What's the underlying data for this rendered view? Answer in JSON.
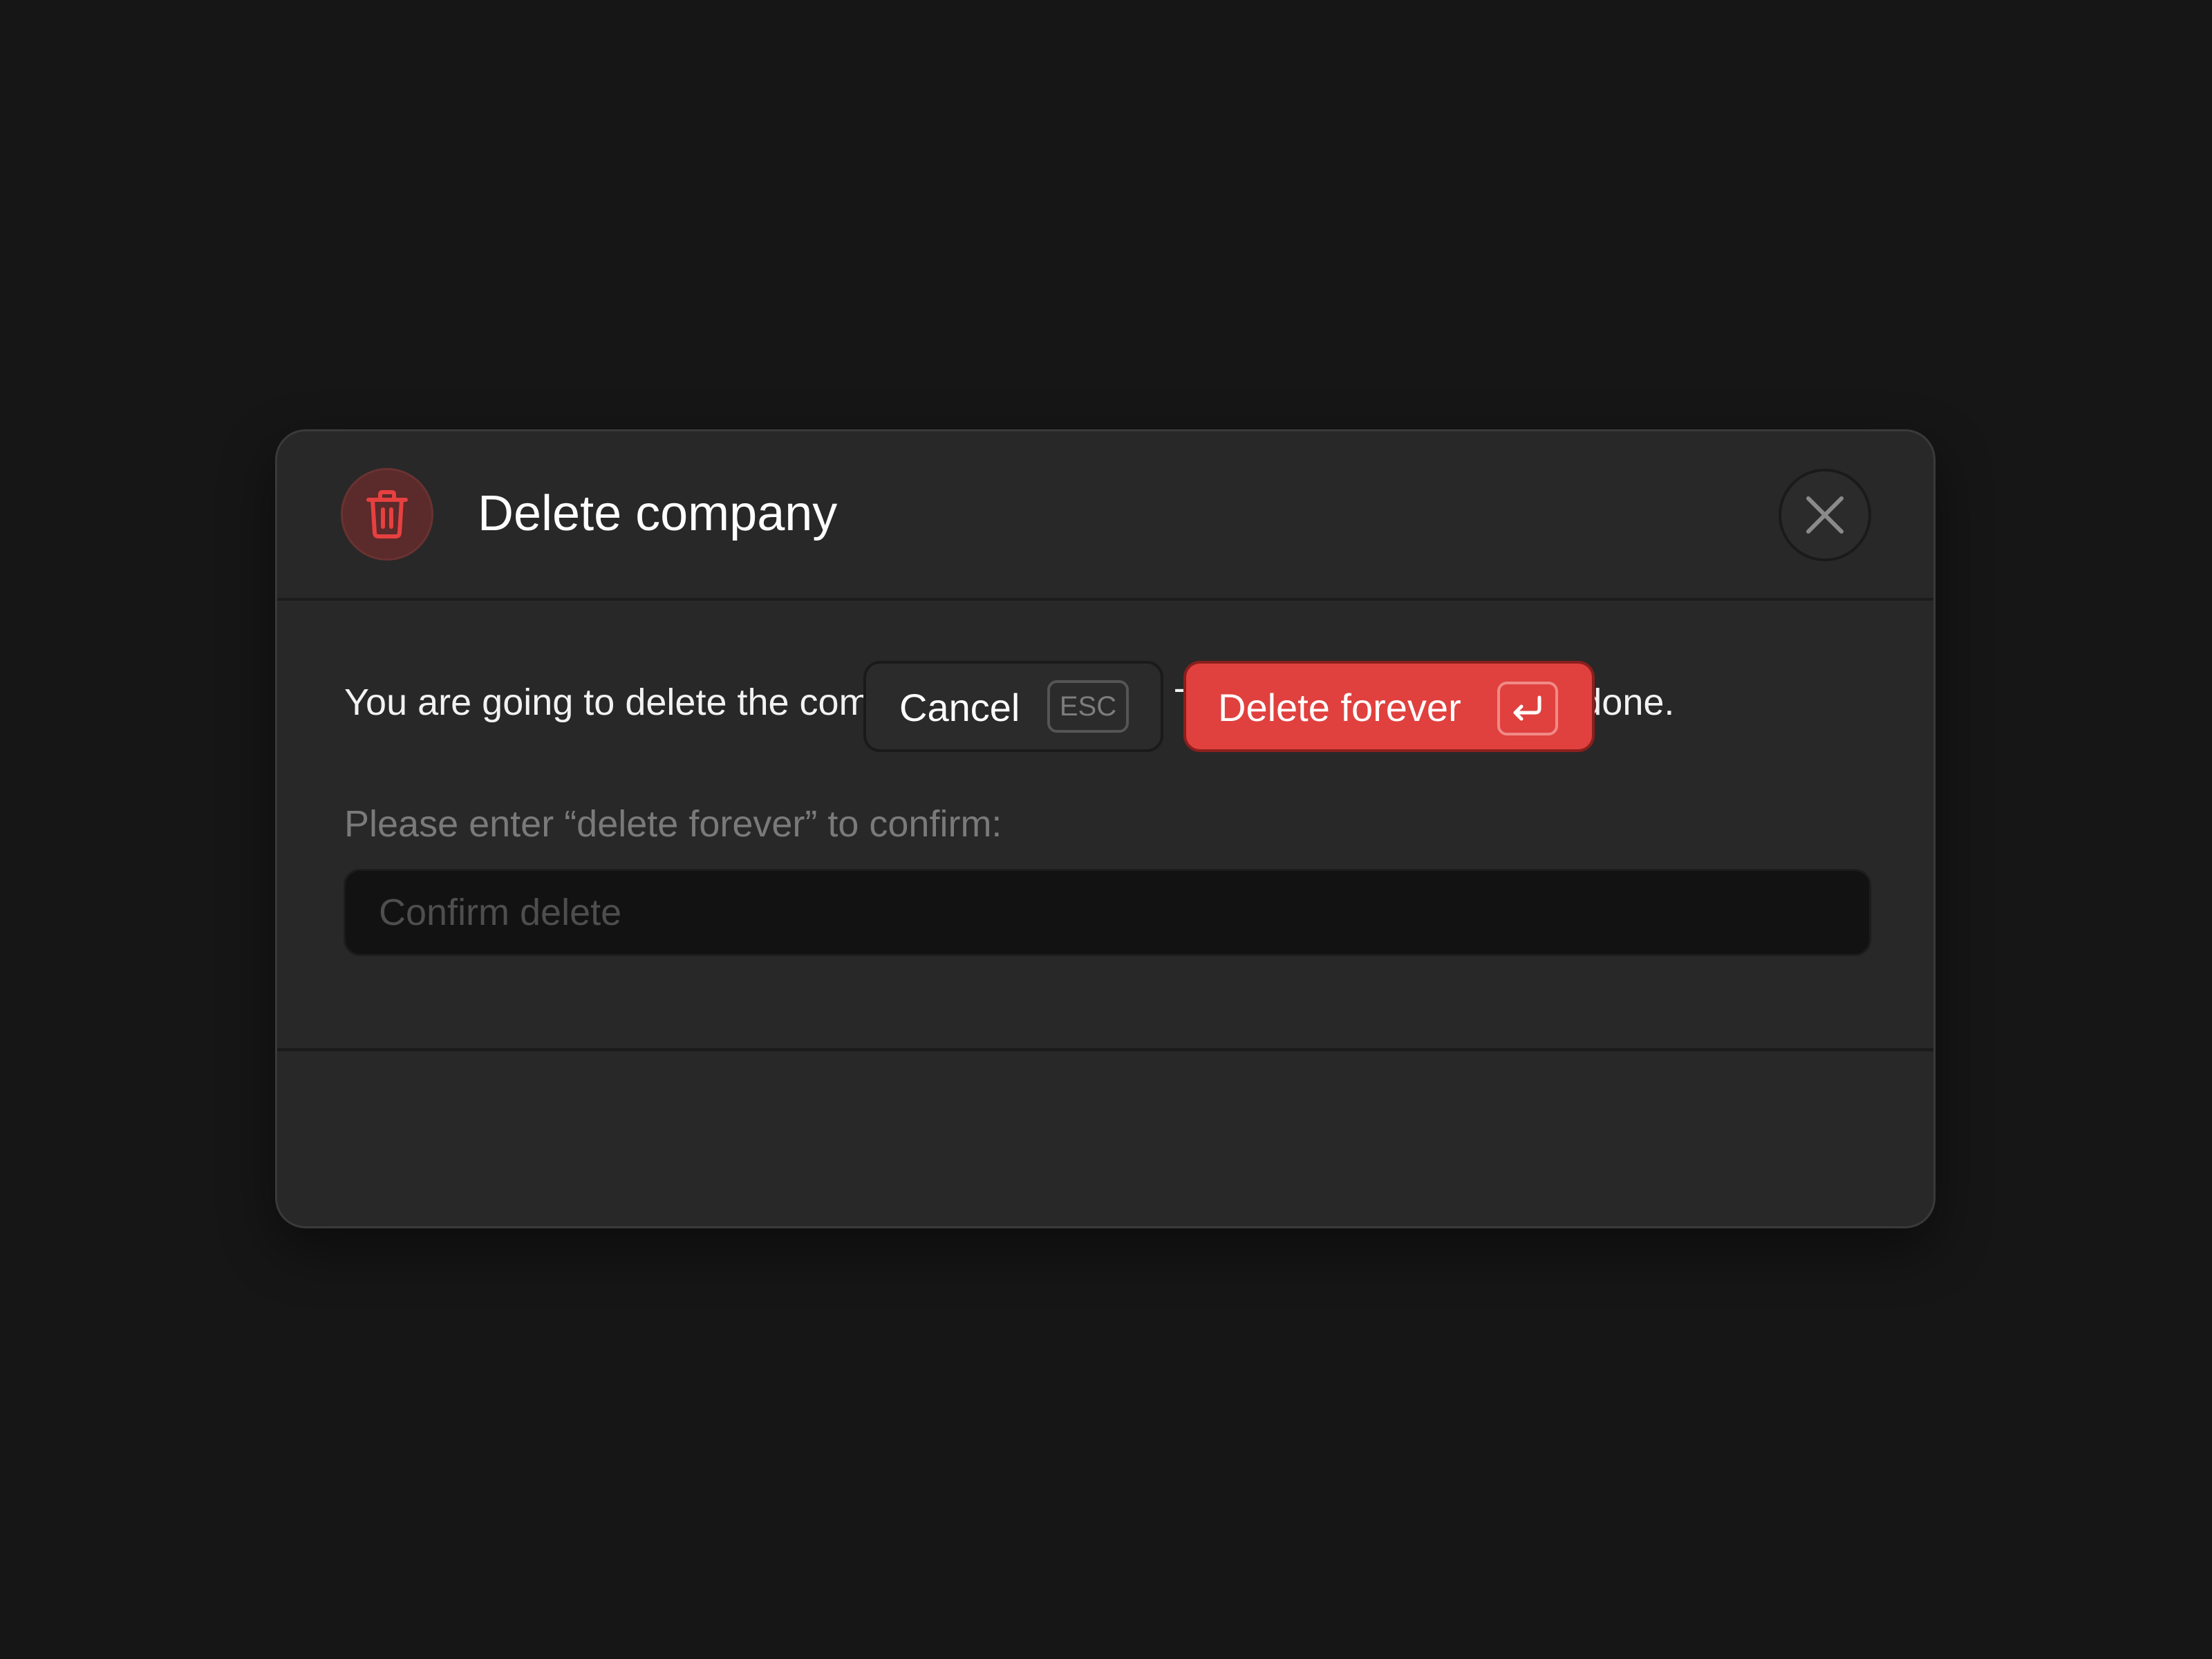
{
  "dialog": {
    "title": "Delete company",
    "description": "You are going to delete the company and its data. This action cannot be undone.",
    "confirm_label": "Please enter “delete forever” to confirm:",
    "confirm_input": {
      "placeholder": "Confirm delete",
      "value": ""
    },
    "icons": {
      "header": "trash-icon",
      "close": "close-icon",
      "enter": "enter-key-icon"
    }
  },
  "footer": {
    "cancel_label": "Cancel",
    "cancel_shortcut": "ESC",
    "delete_label": "Delete forever",
    "delete_shortcut_icon": "enter-key-icon"
  },
  "colors": {
    "background": "#161616",
    "dialog": "#282828",
    "danger": "#e0413e",
    "danger_badge": "#5b2a2a",
    "input_background": "#121212"
  }
}
